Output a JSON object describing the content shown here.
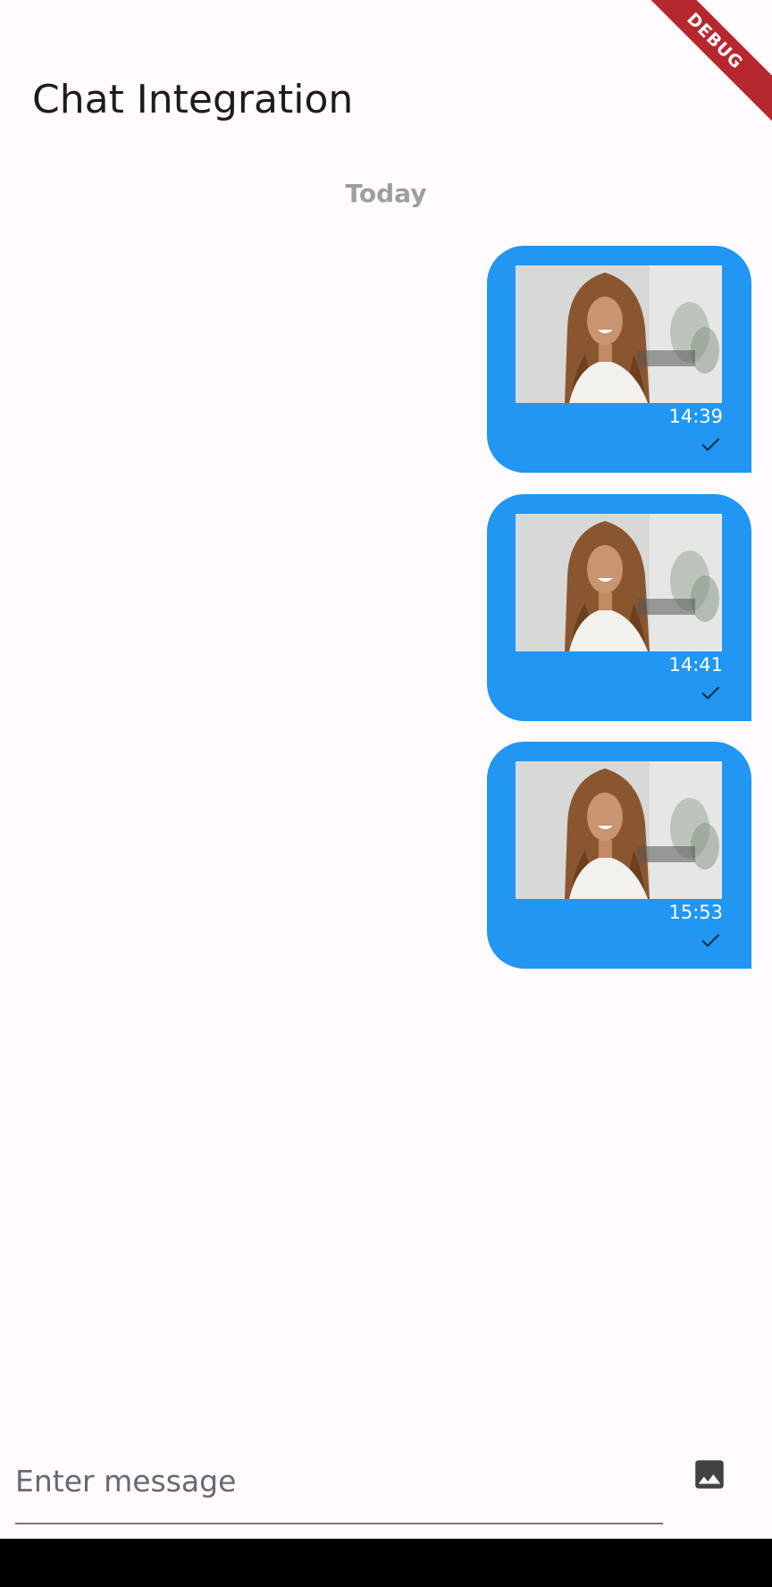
{
  "app_bar": {
    "title": "Chat Integration"
  },
  "debug_banner": {
    "label": "DEBUG"
  },
  "conversation": {
    "date_separator": "Today",
    "messages": [
      {
        "type": "image",
        "time": "14:39",
        "status_icon": "check-icon"
      },
      {
        "type": "image",
        "time": "14:41",
        "status_icon": "check-icon"
      },
      {
        "type": "image",
        "time": "15:53",
        "status_icon": "check-icon"
      }
    ]
  },
  "composer": {
    "placeholder": "Enter message",
    "value": "",
    "image_button_icon": "image-icon"
  },
  "colors": {
    "background": "#fffbfe",
    "bubble": "#2196f3",
    "date_separator": "#9e9e9e",
    "debug_banner": "#b7282e",
    "nav_bar": "#000000"
  }
}
